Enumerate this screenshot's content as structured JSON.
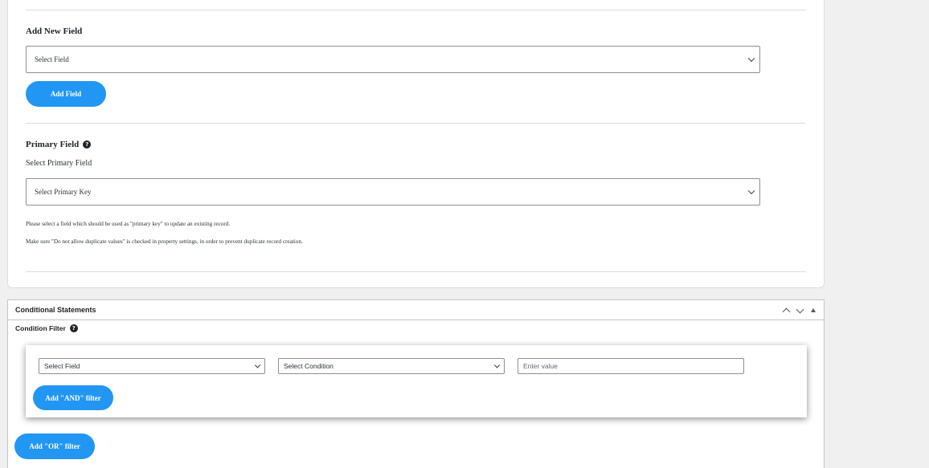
{
  "add_new_field": {
    "title": "Add New Field",
    "select_value": "Select Field",
    "button_label": "Add Field"
  },
  "primary_field": {
    "title": "Primary Field",
    "sublabel": "Select Primary Field",
    "select_value": "Select Primary Key",
    "note1": "Please select a field which should be used as \"primary key\" to update an existing record.",
    "note2": "Make sure \"Do not allow duplicate values\" is checked in property settings, in order to prevent duplicate record creation."
  },
  "conditional": {
    "title": "Conditional Statements",
    "filter_title": "Condition Filter",
    "field_select": "Select Field",
    "condition_select": "Select Condition",
    "value_placeholder": "Enter value",
    "and_button": "Add \"AND\" filter",
    "or_button": "Add \"OR\" filter"
  },
  "colors": {
    "accent": "#2196f3",
    "border": "#dcdcde"
  }
}
